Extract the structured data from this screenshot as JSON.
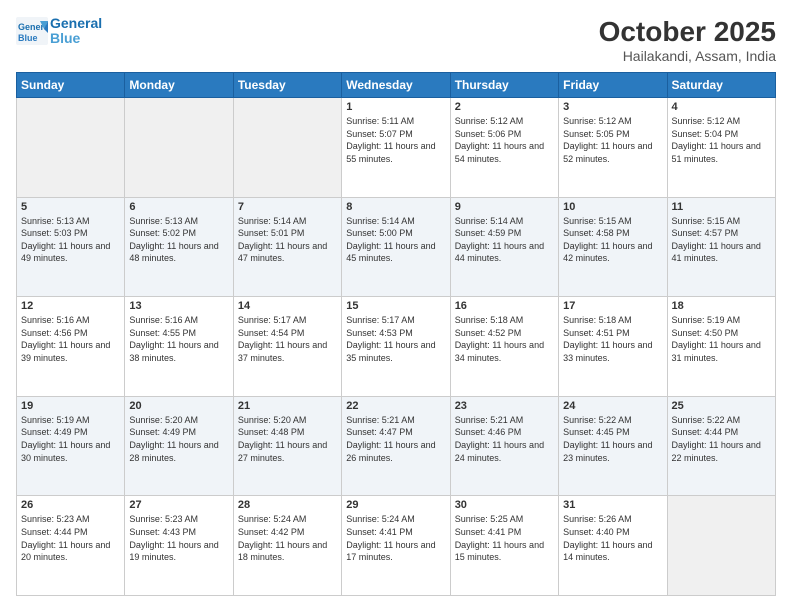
{
  "header": {
    "logo_line1": "General",
    "logo_line2": "Blue",
    "title": "October 2025",
    "location": "Hailakandi, Assam, India"
  },
  "weekdays": [
    "Sunday",
    "Monday",
    "Tuesday",
    "Wednesday",
    "Thursday",
    "Friday",
    "Saturday"
  ],
  "weeks": [
    [
      {
        "day": "",
        "empty": true
      },
      {
        "day": "",
        "empty": true
      },
      {
        "day": "",
        "empty": true
      },
      {
        "day": "1",
        "sunrise": "Sunrise: 5:11 AM",
        "sunset": "Sunset: 5:07 PM",
        "daylight": "Daylight: 11 hours and 55 minutes."
      },
      {
        "day": "2",
        "sunrise": "Sunrise: 5:12 AM",
        "sunset": "Sunset: 5:06 PM",
        "daylight": "Daylight: 11 hours and 54 minutes."
      },
      {
        "day": "3",
        "sunrise": "Sunrise: 5:12 AM",
        "sunset": "Sunset: 5:05 PM",
        "daylight": "Daylight: 11 hours and 52 minutes."
      },
      {
        "day": "4",
        "sunrise": "Sunrise: 5:12 AM",
        "sunset": "Sunset: 5:04 PM",
        "daylight": "Daylight: 11 hours and 51 minutes."
      }
    ],
    [
      {
        "day": "5",
        "sunrise": "Sunrise: 5:13 AM",
        "sunset": "Sunset: 5:03 PM",
        "daylight": "Daylight: 11 hours and 49 minutes."
      },
      {
        "day": "6",
        "sunrise": "Sunrise: 5:13 AM",
        "sunset": "Sunset: 5:02 PM",
        "daylight": "Daylight: 11 hours and 48 minutes."
      },
      {
        "day": "7",
        "sunrise": "Sunrise: 5:14 AM",
        "sunset": "Sunset: 5:01 PM",
        "daylight": "Daylight: 11 hours and 47 minutes."
      },
      {
        "day": "8",
        "sunrise": "Sunrise: 5:14 AM",
        "sunset": "Sunset: 5:00 PM",
        "daylight": "Daylight: 11 hours and 45 minutes."
      },
      {
        "day": "9",
        "sunrise": "Sunrise: 5:14 AM",
        "sunset": "Sunset: 4:59 PM",
        "daylight": "Daylight: 11 hours and 44 minutes."
      },
      {
        "day": "10",
        "sunrise": "Sunrise: 5:15 AM",
        "sunset": "Sunset: 4:58 PM",
        "daylight": "Daylight: 11 hours and 42 minutes."
      },
      {
        "day": "11",
        "sunrise": "Sunrise: 5:15 AM",
        "sunset": "Sunset: 4:57 PM",
        "daylight": "Daylight: 11 hours and 41 minutes."
      }
    ],
    [
      {
        "day": "12",
        "sunrise": "Sunrise: 5:16 AM",
        "sunset": "Sunset: 4:56 PM",
        "daylight": "Daylight: 11 hours and 39 minutes."
      },
      {
        "day": "13",
        "sunrise": "Sunrise: 5:16 AM",
        "sunset": "Sunset: 4:55 PM",
        "daylight": "Daylight: 11 hours and 38 minutes."
      },
      {
        "day": "14",
        "sunrise": "Sunrise: 5:17 AM",
        "sunset": "Sunset: 4:54 PM",
        "daylight": "Daylight: 11 hours and 37 minutes."
      },
      {
        "day": "15",
        "sunrise": "Sunrise: 5:17 AM",
        "sunset": "Sunset: 4:53 PM",
        "daylight": "Daylight: 11 hours and 35 minutes."
      },
      {
        "day": "16",
        "sunrise": "Sunrise: 5:18 AM",
        "sunset": "Sunset: 4:52 PM",
        "daylight": "Daylight: 11 hours and 34 minutes."
      },
      {
        "day": "17",
        "sunrise": "Sunrise: 5:18 AM",
        "sunset": "Sunset: 4:51 PM",
        "daylight": "Daylight: 11 hours and 33 minutes."
      },
      {
        "day": "18",
        "sunrise": "Sunrise: 5:19 AM",
        "sunset": "Sunset: 4:50 PM",
        "daylight": "Daylight: 11 hours and 31 minutes."
      }
    ],
    [
      {
        "day": "19",
        "sunrise": "Sunrise: 5:19 AM",
        "sunset": "Sunset: 4:49 PM",
        "daylight": "Daylight: 11 hours and 30 minutes."
      },
      {
        "day": "20",
        "sunrise": "Sunrise: 5:20 AM",
        "sunset": "Sunset: 4:49 PM",
        "daylight": "Daylight: 11 hours and 28 minutes."
      },
      {
        "day": "21",
        "sunrise": "Sunrise: 5:20 AM",
        "sunset": "Sunset: 4:48 PM",
        "daylight": "Daylight: 11 hours and 27 minutes."
      },
      {
        "day": "22",
        "sunrise": "Sunrise: 5:21 AM",
        "sunset": "Sunset: 4:47 PM",
        "daylight": "Daylight: 11 hours and 26 minutes."
      },
      {
        "day": "23",
        "sunrise": "Sunrise: 5:21 AM",
        "sunset": "Sunset: 4:46 PM",
        "daylight": "Daylight: 11 hours and 24 minutes."
      },
      {
        "day": "24",
        "sunrise": "Sunrise: 5:22 AM",
        "sunset": "Sunset: 4:45 PM",
        "daylight": "Daylight: 11 hours and 23 minutes."
      },
      {
        "day": "25",
        "sunrise": "Sunrise: 5:22 AM",
        "sunset": "Sunset: 4:44 PM",
        "daylight": "Daylight: 11 hours and 22 minutes."
      }
    ],
    [
      {
        "day": "26",
        "sunrise": "Sunrise: 5:23 AM",
        "sunset": "Sunset: 4:44 PM",
        "daylight": "Daylight: 11 hours and 20 minutes."
      },
      {
        "day": "27",
        "sunrise": "Sunrise: 5:23 AM",
        "sunset": "Sunset: 4:43 PM",
        "daylight": "Daylight: 11 hours and 19 minutes."
      },
      {
        "day": "28",
        "sunrise": "Sunrise: 5:24 AM",
        "sunset": "Sunset: 4:42 PM",
        "daylight": "Daylight: 11 hours and 18 minutes."
      },
      {
        "day": "29",
        "sunrise": "Sunrise: 5:24 AM",
        "sunset": "Sunset: 4:41 PM",
        "daylight": "Daylight: 11 hours and 17 minutes."
      },
      {
        "day": "30",
        "sunrise": "Sunrise: 5:25 AM",
        "sunset": "Sunset: 4:41 PM",
        "daylight": "Daylight: 11 hours and 15 minutes."
      },
      {
        "day": "31",
        "sunrise": "Sunrise: 5:26 AM",
        "sunset": "Sunset: 4:40 PM",
        "daylight": "Daylight: 11 hours and 14 minutes."
      },
      {
        "day": "",
        "empty": true
      }
    ]
  ]
}
